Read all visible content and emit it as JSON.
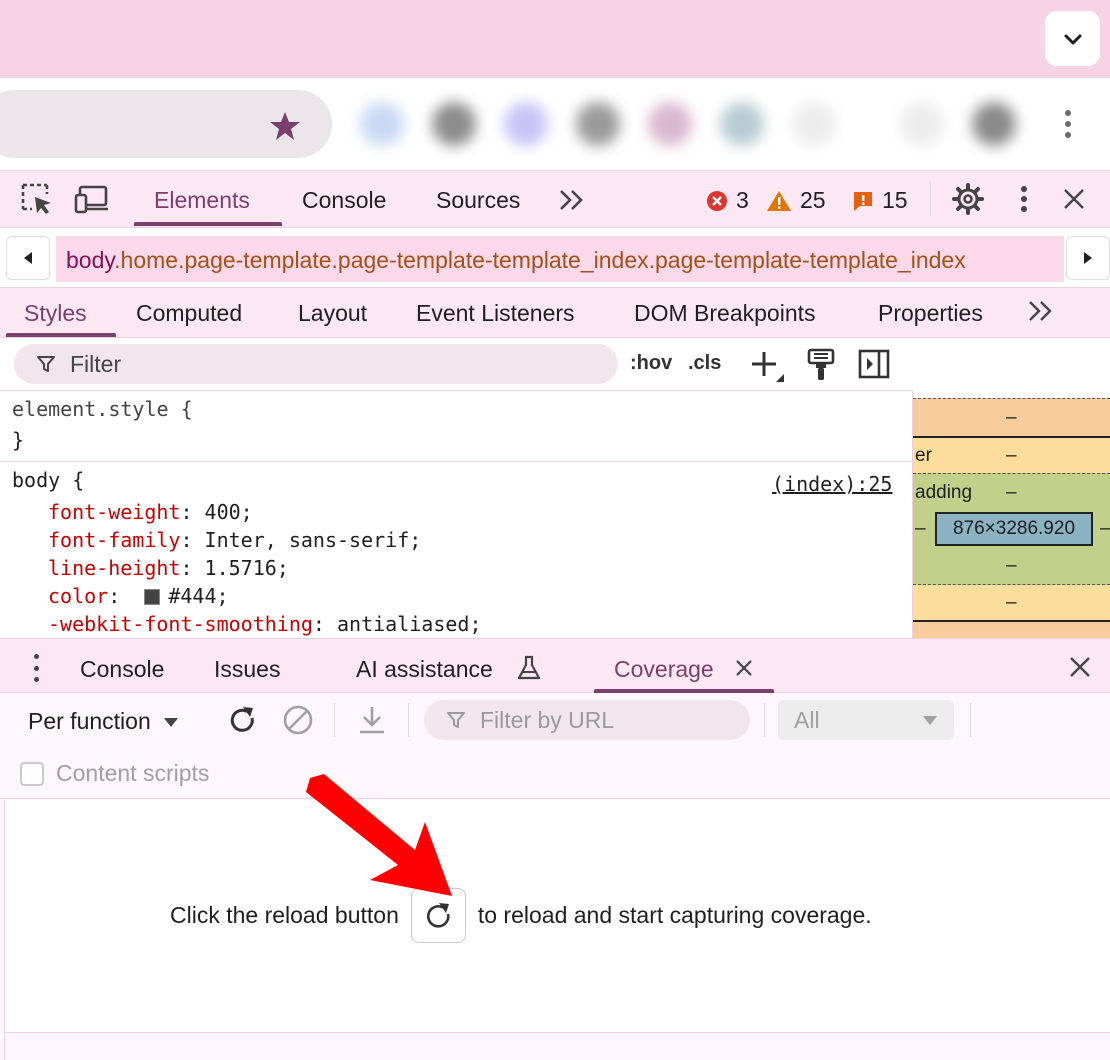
{
  "devtools": {
    "main_tabs": [
      "Elements",
      "Console",
      "Sources"
    ],
    "counters": {
      "errors": "3",
      "warnings": "25",
      "issues": "15"
    }
  },
  "breadcrumb": {
    "tag": "body",
    "classes": ".home.page-template.page-template-template_index.page-template-template_index"
  },
  "styles_tabs": [
    "Styles",
    "Computed",
    "Layout",
    "Event Listeners",
    "DOM Breakpoints",
    "Properties"
  ],
  "styles": {
    "filter_placeholder": "Filter",
    "hov": ":hov",
    "cls": ".cls",
    "element_style_open": "element.style {",
    "element_style_close": "}",
    "body_selector": "body {",
    "source": "(index):25",
    "rules": [
      {
        "prop": "font-weight",
        "value": "400;"
      },
      {
        "prop": "font-family",
        "value": "Inter, sans-serif;"
      },
      {
        "prop": "line-height",
        "value": "1.5716;"
      },
      {
        "prop": "color",
        "value": "#444;"
      },
      {
        "prop": "-webkit-font-smoothing",
        "value": "antialiased;"
      }
    ]
  },
  "box_model": {
    "dash": "–",
    "border_label": "er",
    "padding_label": "adding",
    "content": "876×3286.920"
  },
  "drawer": {
    "tabs": [
      "Console",
      "Issues",
      "AI assistance",
      "Coverage"
    ]
  },
  "coverage": {
    "mode": "Per function",
    "url_filter_placeholder": "Filter by URL",
    "type_filter": "All",
    "content_scripts_label": "Content scripts",
    "empty_before": "Click the reload button",
    "empty_after": "to reload and start capturing coverage."
  },
  "colors": {
    "accent": "#7b3f6e",
    "titlebar": "#f6d4e5",
    "margin": "#f9cc9d",
    "border": "#fddd9b",
    "padding": "#c3d08b",
    "content": "#8bb3c4",
    "annotation_arrow": "#ff0000"
  }
}
